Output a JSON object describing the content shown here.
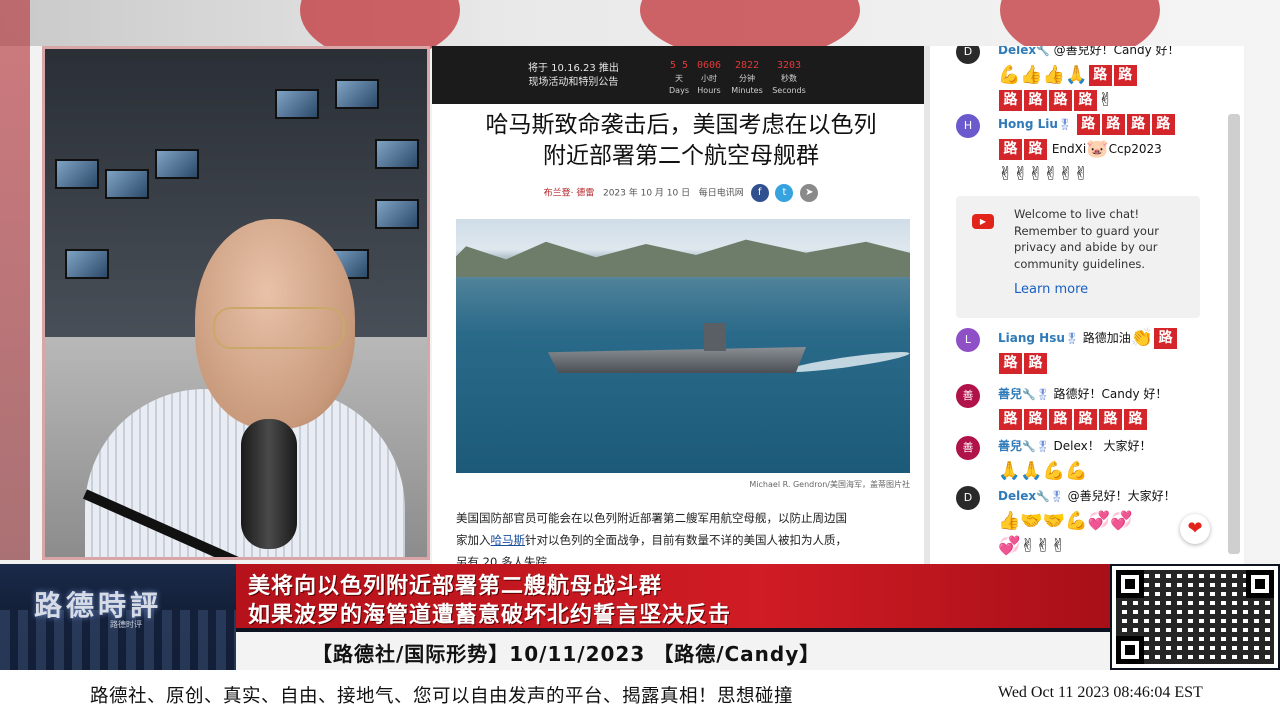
{
  "countdown": {
    "line1": "将于 10.16.23 推出",
    "line2": "现场活动和特别公告",
    "units": [
      {
        "value": "5 5",
        "label1": "天",
        "label2": "Days"
      },
      {
        "value": "0606",
        "label1": "小时",
        "label2": "Hours"
      },
      {
        "value": "2822",
        "label1": "分钟",
        "label2": "Minutes"
      },
      {
        "value": "3203",
        "label1": "秒数",
        "label2": "Seconds"
      }
    ]
  },
  "article": {
    "title_line1": "哈马斯致命袭击后，美国考虑在以色列",
    "title_line2": "附近部署第二个航空母舰群",
    "author": "布兰登· 德雷",
    "date": "2023 年 10 月 10 日",
    "source": "每日电讯网",
    "photo_caption": "Michael R. Gendron/美国海军，盖蒂图片社",
    "body_line1": "美国国防部官员可能会在以色列附近部署第二艘军用航空母舰，以防止周边国",
    "body_line2_pre": "家加入",
    "body_line2_link": "哈马斯",
    "body_line2_post": "针对以色列的全面战争，目前有数量不详的美国人被扣为人质，",
    "body_line3": "另有 20 多人失踪"
  },
  "chat": {
    "msg1": {
      "name": "Delex",
      "text": "@善兒好！Candy 好！"
    },
    "msg2": {
      "avatar": "H",
      "name": "Hong Liu",
      "text": "EndXi",
      "text2": "Ccp2023"
    },
    "info": {
      "text": "Welcome to live chat! Remember to guard your privacy and abide by our community guidelines.",
      "link": "Learn more"
    },
    "msg3": {
      "avatar": "L",
      "name": "Liang Hsu",
      "text": "路德加油"
    },
    "msg4": {
      "name": "善兒",
      "text": "路德好！Candy 好！"
    },
    "msg5": {
      "name": "善兒",
      "text": "Delex！ 大家好！"
    },
    "msg6": {
      "name": "Delex",
      "text": "@善兒好！大家好！"
    },
    "lu_char": "路",
    "avatar_colors": {
      "H": "#6a5acd",
      "L": "#8e4fc7",
      "shaner": "#b0124a",
      "delex": "#2a2a2a"
    }
  },
  "lower_third": {
    "logo": "路德時評",
    "logo_sub": "路德时评",
    "headline1": "美将向以色列附近部署第二艘航母战斗群",
    "headline2": "如果波罗的海管道遭蓄意破坏北约誓言坚决反击",
    "tagline": "【路德社/国际形势】10/11/2023 【路德/Candy】"
  },
  "ticker": {
    "text": "路德社、原创、真实、自由、接地气、您可以自由发声的平台、揭露真相！思想碰撞",
    "clock": "Wed Oct 11 2023 08:46:04 EST"
  },
  "colors": {
    "accent_red": "#d01c24",
    "link_blue": "#1a5fc1",
    "name_blue": "#2f7ab8"
  }
}
